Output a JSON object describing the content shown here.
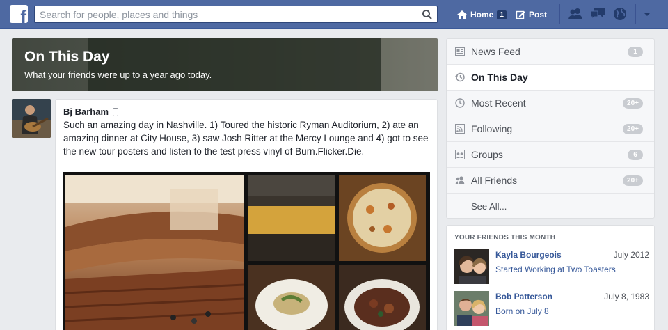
{
  "topbar": {
    "logo": "f",
    "search_placeholder": "Search for people, places and things",
    "home_label": "Home",
    "home_badge": "1",
    "post_label": "Post"
  },
  "cover": {
    "title": "On This Day",
    "subtitle": "What your friends were up to a year ago today."
  },
  "story": {
    "author": "Bj Barham",
    "text": "Such an amazing day in Nashville. 1) Toured the historic Ryman Auditorium, 2) ate an amazing dinner at City House, 3) saw Josh Ritter at the Mercy Lounge and 4) got to see the new tour posters and listen to the test press vinyl of Burn.Flicker.Die."
  },
  "sidebar": {
    "items": [
      {
        "label": "News Feed",
        "badge": "1",
        "icon": "news-feed-icon"
      },
      {
        "label": "On This Day",
        "badge": "",
        "icon": "clock-back-icon"
      },
      {
        "label": "Most Recent",
        "badge": "20+",
        "icon": "clock-icon"
      },
      {
        "label": "Following",
        "badge": "20+",
        "icon": "rss-icon"
      },
      {
        "label": "Groups",
        "badge": "6",
        "icon": "groups-icon"
      },
      {
        "label": "All Friends",
        "badge": "20+",
        "icon": "friends-icon"
      }
    ],
    "see_all": "See All..."
  },
  "friends": {
    "heading": "YOUR FRIENDS THIS MONTH",
    "items": [
      {
        "name": "Kayla Bourgeois",
        "date": "July 2012",
        "event": "Started Working at Two Toasters"
      },
      {
        "name": "Bob Patterson",
        "date": "July 8, 1983",
        "event": "Born on July 8"
      }
    ]
  },
  "colors": {
    "topbar": "#4e69a2",
    "link": "#365899",
    "badge": "#c9ccd1"
  }
}
